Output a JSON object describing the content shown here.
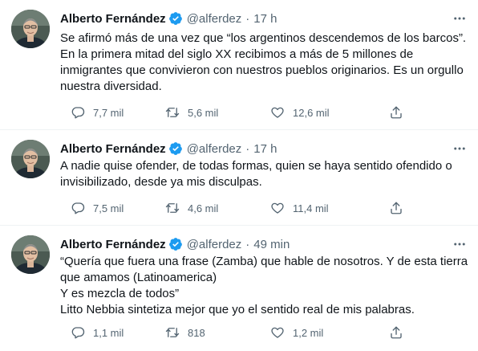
{
  "colors": {
    "text": "#0f1419",
    "muted": "#536471",
    "verified": "#1d9bf0",
    "separator": "#eff3f4"
  },
  "icons": {
    "reply": "speech-bubble-icon",
    "retweet": "retweet-arrows-icon",
    "like": "heart-icon",
    "share": "share-upload-icon",
    "more": "more-dots-icon",
    "verified": "verified-badge-icon"
  },
  "tweets": [
    {
      "author": "Alberto Fernández",
      "handle": "@alferdez",
      "separator": "·",
      "time": "17 h",
      "lines": [
        "Se afirmó más de una vez que “los argentinos descendemos de los barcos”.",
        "En la primera mitad del siglo XX recibimos a más de 5 millones de",
        "inmigrantes que convivieron con nuestros pueblos originarios. Es un orgullo",
        "nuestra diversidad."
      ],
      "replies": "7,7 mil",
      "retweets": "5,6 mil",
      "likes": "12,6 mil"
    },
    {
      "author": "Alberto Fernández",
      "handle": "@alferdez",
      "separator": "·",
      "time": "17 h",
      "lines": [
        "A nadie quise ofender, de todas formas, quien se haya sentido ofendido o",
        "invisibilizado, desde ya mis disculpas."
      ],
      "replies": "7,5 mil",
      "retweets": "4,6 mil",
      "likes": "11,4 mil"
    },
    {
      "author": "Alberto Fernández",
      "handle": "@alferdez",
      "separator": "·",
      "time": "49 min",
      "lines": [
        "“Quería que fuera una frase (Zamba) que hable de nosotros. Y de esta tierra",
        "que amamos (Latinoamerica)",
        "Y es mezcla de todos”",
        "Litto Nebbia sintetiza mejor que yo el sentido real de mis palabras."
      ],
      "replies": "1,1 mil",
      "retweets": "818",
      "likes": "1,2 mil"
    }
  ]
}
